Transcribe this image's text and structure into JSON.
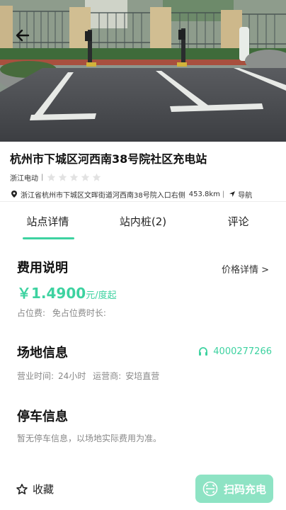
{
  "station": {
    "title": "杭州市下城区河西南38号院社区充电站",
    "operator": "浙江电动",
    "separator": "|",
    "rating_stars": 5,
    "rating_filled": 0,
    "address": "浙江省杭州市下城区文晖街道河西南38号院入口右侧",
    "distance": "453.8km",
    "nav_sep": "|",
    "nav_label": "导航"
  },
  "tabs": [
    {
      "label": "站点详情",
      "active": true
    },
    {
      "label": "站内桩(2)",
      "active": false
    },
    {
      "label": "评论",
      "active": false
    }
  ],
  "fee": {
    "title": "费用说明",
    "detail_link": "价格详情 >",
    "price": "￥1.4900",
    "price_unit": "元/度起",
    "occupy_fee_label": "占位费:",
    "occupy_free_label": "免占位费时长:"
  },
  "site": {
    "title": "场地信息",
    "phone": "4000277266",
    "hours_label": "营业时间:",
    "hours_value": "24小时",
    "operator_label": "运营商:",
    "operator_value": "安培直营"
  },
  "parking": {
    "title": "停车信息",
    "note": "暂无停车信息，以场地实际费用为准。"
  },
  "bottom": {
    "favorite_label": "收藏",
    "scan_label": "扫码充电"
  },
  "colors": {
    "accent": "#3dd2a0",
    "scan_button": "#8ee3c4"
  }
}
